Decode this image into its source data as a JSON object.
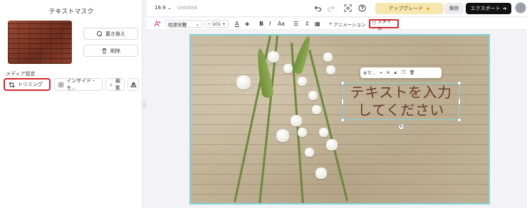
{
  "left_panel": {
    "title": "テキストマスク",
    "replace_label": "置き換え",
    "delete_label": "削除",
    "media_settings_label": "メディア設定",
    "trim_label": "トリミング",
    "inside_label": "インサイド・モ...",
    "edit_label": "編集"
  },
  "topbar": {
    "ratio": "16:9",
    "title": "Untitled",
    "upgrade_label": "アップグレード",
    "save_label": "保存",
    "export_label": "エクスポート"
  },
  "format_bar": {
    "font_name": "昭源宋體",
    "font_size": "101",
    "animation_label": "アニメーション",
    "style_label": "スタイル"
  },
  "canvas": {
    "text_line1": "テキストを入力",
    "text_line2": "してください",
    "mini_toolbar_label": "マ..."
  },
  "colors": {
    "accent_red": "#d9272e",
    "selection_cyan": "#7fd3dc",
    "export_bg": "#111111",
    "upgrade_bg": "#f6e7b0"
  }
}
